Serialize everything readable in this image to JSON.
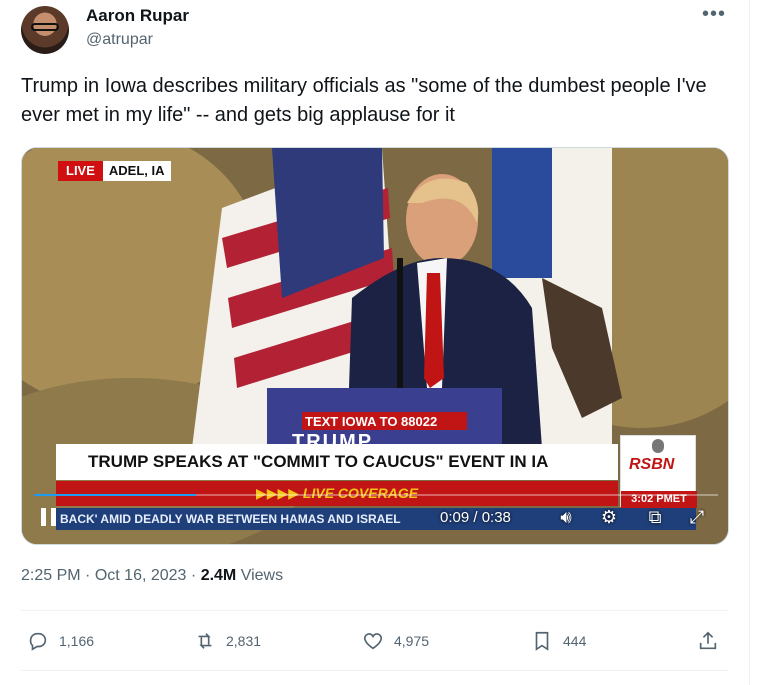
{
  "author": {
    "name": "Aaron Rupar",
    "handle": "@atrupar"
  },
  "tweet": {
    "text": "Trump in Iowa describes military officials as \"some of the dumbest people I've ever met in my life\" -- and gets big applause for it"
  },
  "video": {
    "live_label": "LIVE",
    "location": "ADEL, IA",
    "podium_text": "TEXT IOWA TO 88022",
    "podium_name": "TRUMP",
    "headline": "TRUMP SPEAKS AT \"COMMIT TO CAUCUS\" EVENT IN IA",
    "coverage": "▶▶▶▶ LIVE COVERAGE",
    "ticker": "BACK' AMID DEADLY WAR BETWEEN HAMAS AND ISRAEL",
    "network": "RSBN",
    "clock": "3:02 PMET",
    "timecode": "0:09 / 0:38",
    "progress": 0.237
  },
  "meta": {
    "time": "2:25 PM",
    "separator": "·",
    "date": "Oct 16, 2023",
    "views_count": "2.4M",
    "views_label": "Views"
  },
  "actions": {
    "replies": "1,166",
    "retweets": "2,831",
    "likes": "4,975",
    "bookmarks": "444"
  },
  "colors": {
    "accent": "#1d9bf0",
    "text_secondary": "#536471",
    "news_red": "#c11414",
    "news_blue": "#1f3f7a"
  }
}
